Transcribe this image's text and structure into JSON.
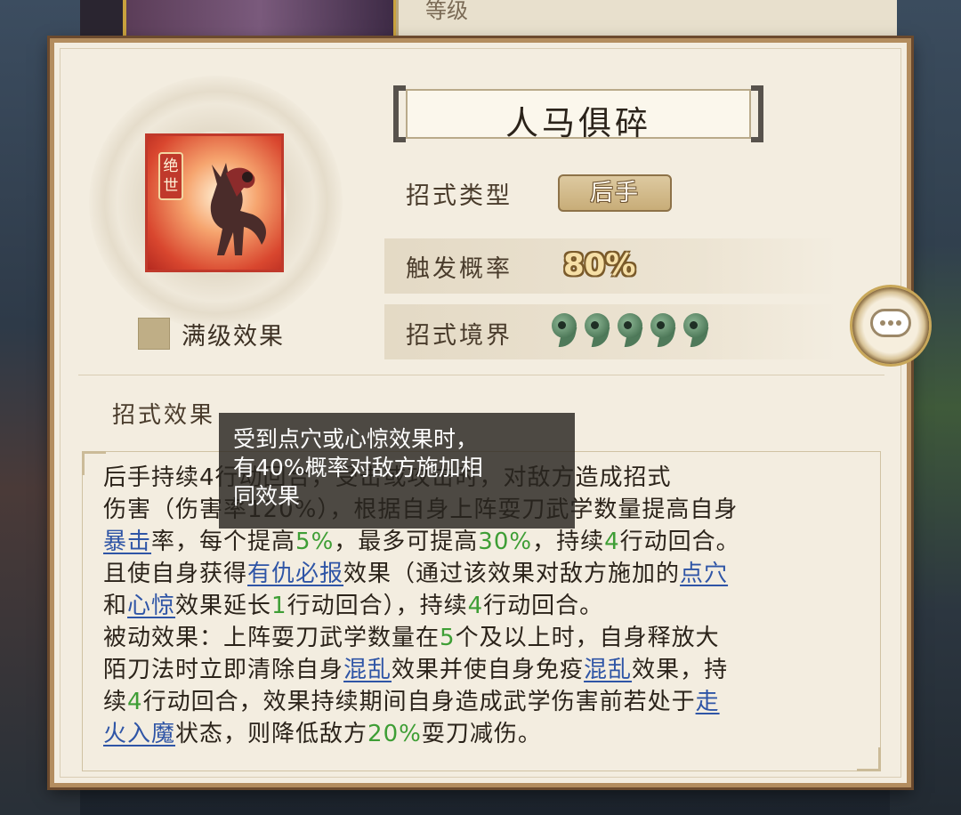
{
  "background": {
    "top_level_label": "等级"
  },
  "skill": {
    "name": "人马俱碎",
    "icon_tag": "绝世",
    "max_level_label": "满级效果",
    "type_label": "招式类型",
    "type_value": "后手",
    "rate_label": "触发概率",
    "rate_value": "80%",
    "realm_label": "招式境界",
    "realm_level": 5,
    "realm_icon": "magatama-icon"
  },
  "effects": {
    "title": "招式效果",
    "description": [
      [
        {
          "t": "后手持续4行动回合，受击或攻击时，对敌方造成招式"
        }
      ],
      [
        {
          "t": "伤害（伤害率120%），根据自身上阵耍刀武学数量提高自身"
        }
      ],
      [
        {
          "t": "暴击",
          "k": "kw"
        },
        {
          "t": "率，每个提高"
        },
        {
          "t": "5%",
          "k": "num"
        },
        {
          "t": "，最多可提高"
        },
        {
          "t": "30%",
          "k": "num"
        },
        {
          "t": "，持续"
        },
        {
          "t": "4",
          "k": "num"
        },
        {
          "t": "行动回合。"
        }
      ],
      [
        {
          "t": "且使自身获得"
        },
        {
          "t": "有仇必报",
          "k": "kw"
        },
        {
          "t": "效果（通过该效果对敌方施加的"
        },
        {
          "t": "点穴",
          "k": "kw"
        }
      ],
      [
        {
          "t": "和"
        },
        {
          "t": "心惊",
          "k": "kw"
        },
        {
          "t": "效果延长"
        },
        {
          "t": "1",
          "k": "num"
        },
        {
          "t": "行动回合），持续"
        },
        {
          "t": "4",
          "k": "num"
        },
        {
          "t": "行动回合。"
        }
      ],
      [
        {
          "t": "被动效果：上阵耍刀武学数量在"
        },
        {
          "t": "5",
          "k": "num"
        },
        {
          "t": "个及以上时，自身释放大"
        }
      ],
      [
        {
          "t": "陌刀法时立即清除自身"
        },
        {
          "t": "混乱",
          "k": "kw"
        },
        {
          "t": "效果并使自身免疫"
        },
        {
          "t": "混乱",
          "k": "kw"
        },
        {
          "t": "效果，持"
        }
      ],
      [
        {
          "t": "续"
        },
        {
          "t": "4",
          "k": "num"
        },
        {
          "t": "行动回合，效果持续期间自身造成武学伤害前若处于"
        },
        {
          "t": "走",
          "k": "kw"
        }
      ],
      [
        {
          "t": "火入魔",
          "k": "kw"
        },
        {
          "t": "状态，则降低敌方"
        },
        {
          "t": "20%",
          "k": "num"
        },
        {
          "t": "耍刀减伤。"
        }
      ]
    ]
  },
  "tooltip": {
    "lines": [
      "受到点穴或心惊效果时，",
      "有40%概率对敌方施加相",
      "同效果"
    ]
  },
  "chat_button": {
    "icon": "chat-bubble-icon"
  }
}
